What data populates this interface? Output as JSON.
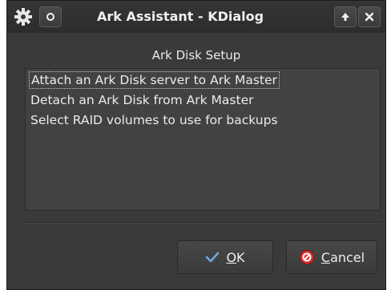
{
  "window": {
    "title": "Ark Assistant - KDialog",
    "icons": {
      "menu": "gear-icon",
      "pin": "circle-dot-icon",
      "keep_above": "up-arrow-icon",
      "close": "close-x-icon"
    }
  },
  "dialog": {
    "heading": "Ark Disk Setup",
    "items": [
      "Attach an Ark Disk server to Ark Master",
      "Detach an Ark Disk from Ark Master",
      "Select RAID volumes to use for backups"
    ],
    "selected_index": 0
  },
  "buttons": {
    "ok_label": "OK",
    "cancel_label": "Cancel",
    "ok_icon": "checkmark-icon",
    "cancel_icon": "cancel-circle-icon"
  },
  "colors": {
    "window_bg": "#3a3a3a",
    "list_bg": "#424242",
    "text": "#ececec",
    "check_blue": "#6fa8dc",
    "cancel_red": "#d93030"
  }
}
